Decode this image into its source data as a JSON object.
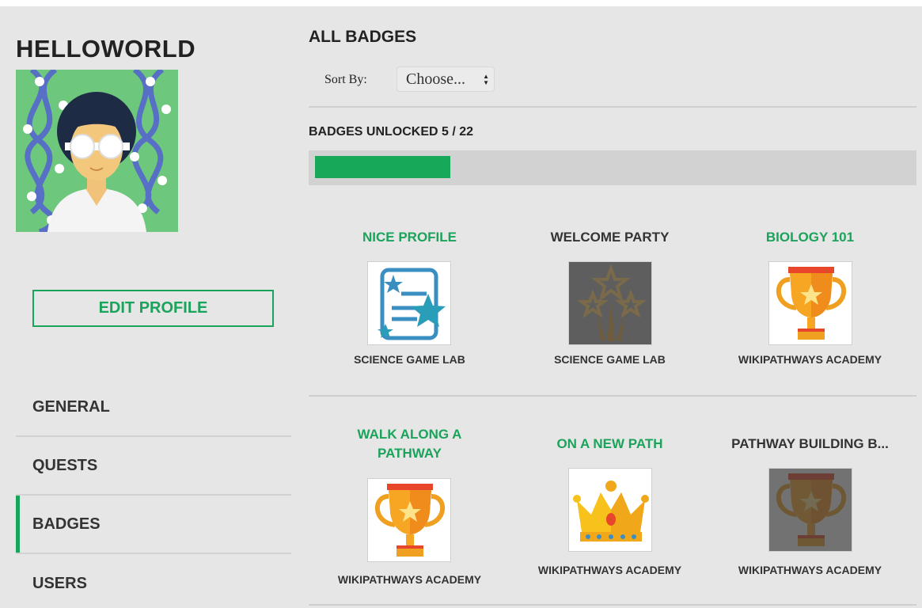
{
  "user": {
    "name": "HELLOWORLD",
    "avatar_icon": "scientist-avatar-icon"
  },
  "sidebar": {
    "edit_label": "EDIT PROFILE",
    "items": [
      {
        "label": "GENERAL",
        "active": false
      },
      {
        "label": "QUESTS",
        "active": false
      },
      {
        "label": "BADGES",
        "active": true
      },
      {
        "label": "USERS",
        "active": false
      }
    ]
  },
  "main": {
    "title": "ALL BADGES",
    "sort": {
      "label": "Sort By:",
      "value": "Choose..."
    },
    "progress": {
      "label": "BADGES UNLOCKED 5 / 22",
      "unlocked": 5,
      "total": 22
    },
    "badges": [
      {
        "title": "NICE PROFILE",
        "org": "SCIENCE GAME LAB",
        "icon": "certificate-icon",
        "unlocked": true
      },
      {
        "title": "WELCOME PARTY",
        "org": "SCIENCE GAME LAB",
        "icon": "fireworks-icon",
        "unlocked": false
      },
      {
        "title": "BIOLOGY 101",
        "org": "WIKIPATHWAYS ACADEMY",
        "icon": "trophy-icon",
        "unlocked": true
      },
      {
        "title": "WALK ALONG A",
        "title2": "PATHWAY",
        "org": "WIKIPATHWAYS ACADEMY",
        "icon": "trophy-icon",
        "unlocked": true
      },
      {
        "title": "ON A NEW PATH",
        "org": "WIKIPATHWAYS ACADEMY",
        "icon": "crown-icon",
        "unlocked": true
      },
      {
        "title": "PATHWAY BUILDING B...",
        "org": "WIKIPATHWAYS ACADEMY",
        "icon": "trophy-icon",
        "unlocked": false
      }
    ]
  },
  "colors": {
    "accent": "#1aa35a",
    "background": "#e6e6e6",
    "locked_text": "#333333"
  }
}
